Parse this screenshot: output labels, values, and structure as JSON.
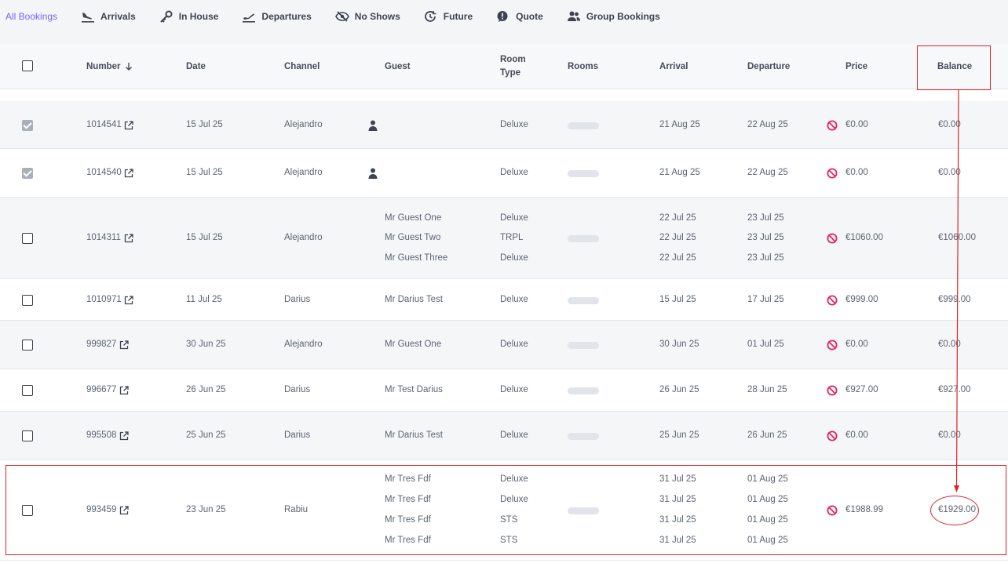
{
  "tabs": [
    {
      "label": "All Bookings",
      "icon": "none"
    },
    {
      "label": "Arrivals",
      "icon": "plane-landing-icon"
    },
    {
      "label": "In House",
      "icon": "key-icon"
    },
    {
      "label": "Departures",
      "icon": "plane-takeoff-icon"
    },
    {
      "label": "No Shows",
      "icon": "eye-off-icon"
    },
    {
      "label": "Future",
      "icon": "clock-forward-icon"
    },
    {
      "label": "Quote",
      "icon": "quote-bubble-icon"
    },
    {
      "label": "Group Bookings",
      "icon": "users-icon"
    }
  ],
  "table": {
    "headers": {
      "number": "Number",
      "date": "Date",
      "channel": "Channel",
      "guest": "Guest",
      "room_type_1": "Room",
      "room_type_2": "Type",
      "rooms": "Rooms",
      "arrival": "Arrival",
      "departure": "Departure",
      "price": "Price",
      "balance": "Balance"
    },
    "rows": [
      {
        "checked": true,
        "number": "1014541",
        "date": "15 Jul 25",
        "channel": "Alejandro",
        "guests": [],
        "guest_icon": "person-icon",
        "room_types": [
          "Deluxe"
        ],
        "arrivals": [
          "21 Aug 25"
        ],
        "departures": [
          "22 Aug 25"
        ],
        "price": "€0.00",
        "balance": "€0.00"
      },
      {
        "checked": true,
        "number": "1014540",
        "date": "15 Jul 25",
        "channel": "Alejandro",
        "guests": [],
        "guest_icon": "person-icon",
        "room_types": [
          "Deluxe"
        ],
        "arrivals": [
          "21 Aug 25"
        ],
        "departures": [
          "22 Aug 25"
        ],
        "price": "€0.00",
        "balance": "€0.00"
      },
      {
        "checked": false,
        "number": "1014311",
        "date": "15 Jul 25",
        "channel": "Alejandro",
        "guests": [
          "Mr Guest One",
          "Mr Guest Two",
          "Mr Guest Three"
        ],
        "room_types": [
          "Deluxe",
          "TRPL",
          "Deluxe"
        ],
        "arrivals": [
          "22 Jul 25",
          "22 Jul 25",
          "22 Jul 25"
        ],
        "departures": [
          "23 Jul 25",
          "23 Jul 25",
          "23 Jul 25"
        ],
        "price": "€1060.00",
        "balance": "€1060.00"
      },
      {
        "checked": false,
        "number": "1010971",
        "date": "11 Jul 25",
        "channel": "Darius",
        "guests": [
          "Mr Darius Test"
        ],
        "room_types": [
          "Deluxe"
        ],
        "arrivals": [
          "15 Jul 25"
        ],
        "departures": [
          "17 Jul 25"
        ],
        "price": "€999.00",
        "balance": "€999.00"
      },
      {
        "checked": false,
        "number": "999827",
        "date": "30 Jun 25",
        "channel": "Alejandro",
        "guests": [
          "Mr Guest One"
        ],
        "room_types": [
          "Deluxe"
        ],
        "arrivals": [
          "30 Jun 25"
        ],
        "departures": [
          "01 Jul 25"
        ],
        "price": "€0.00",
        "balance": "€0.00"
      },
      {
        "checked": false,
        "number": "996677",
        "date": "26 Jun 25",
        "channel": "Darius",
        "guests": [
          "Mr Test Darius"
        ],
        "room_types": [
          "Deluxe"
        ],
        "arrivals": [
          "26 Jun 25"
        ],
        "departures": [
          "28 Jun 25"
        ],
        "price": "€927.00",
        "balance": "€927.00"
      },
      {
        "checked": false,
        "number": "995508",
        "date": "25 Jun 25",
        "channel": "Darius",
        "guests": [
          "Mr Darius Test"
        ],
        "room_types": [
          "Deluxe"
        ],
        "arrivals": [
          "25 Jun 25"
        ],
        "departures": [
          "26 Jun 25"
        ],
        "price": "€0.00",
        "balance": "€0.00"
      },
      {
        "checked": false,
        "number": "993459",
        "date": "23 Jun 25",
        "channel": "Rabiu",
        "guests": [
          "Mr Tres Fdf",
          "Mr Tres Fdf",
          "Mr Tres Fdf",
          "Mr Tres Fdf"
        ],
        "room_types": [
          "Deluxe",
          "Deluxe",
          "STS",
          "STS"
        ],
        "arrivals": [
          "31 Jul 25",
          "31 Jul 25",
          "31 Jul 25",
          "31 Jul 25"
        ],
        "departures": [
          "01 Aug 25",
          "01 Aug 25",
          "01 Aug 25",
          "01 Aug 25"
        ],
        "price": "€1988.99",
        "balance": "€1929.00"
      }
    ]
  },
  "colors": {
    "accent": "#7b61ff",
    "annotation": "#d9242a",
    "no_icon": "#e0245e"
  }
}
